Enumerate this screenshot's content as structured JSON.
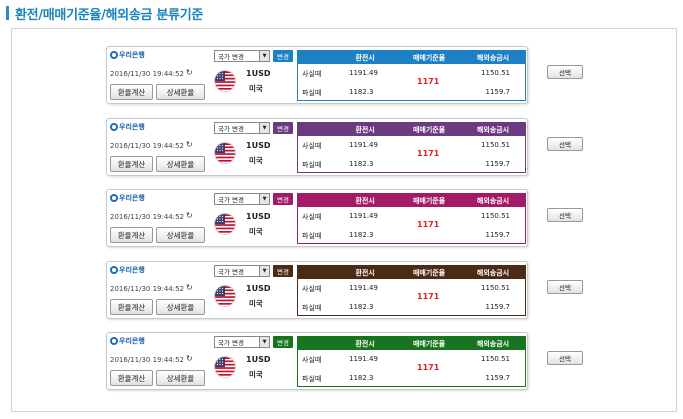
{
  "page": {
    "title": "환전/매매기준율/해외송금 분류기준"
  },
  "widget_common": {
    "bank_name": "우리은행",
    "timestamp": "2016/11/30 19:44:52",
    "refresh_icon": "refresh-icon",
    "calc_button": "환율계산",
    "detail_button": "상세환율",
    "country_select": "국가 변경",
    "change_button": "변경",
    "currency_amount": "1USD",
    "currency_name": "미국",
    "flag_icon": "us-flag-icon",
    "headers": [
      "",
      "환전시",
      "매매기준율",
      "해외송금시"
    ],
    "row_buy": {
      "label": "사실때",
      "cash": "1191.49",
      "remit": "1150.51"
    },
    "row_sell": {
      "label": "파실때",
      "cash": "1182.3",
      "remit": "1159.7"
    },
    "base_rate": "1171",
    "select_button": "선택"
  },
  "themes": [
    {
      "name": "blue",
      "color": "#1d7fc4"
    },
    {
      "name": "purple",
      "color": "#6b3a80"
    },
    {
      "name": "magenta",
      "color": "#a31a66"
    },
    {
      "name": "brown",
      "color": "#4d2a13"
    },
    {
      "name": "green",
      "color": "#16751e"
    }
  ]
}
